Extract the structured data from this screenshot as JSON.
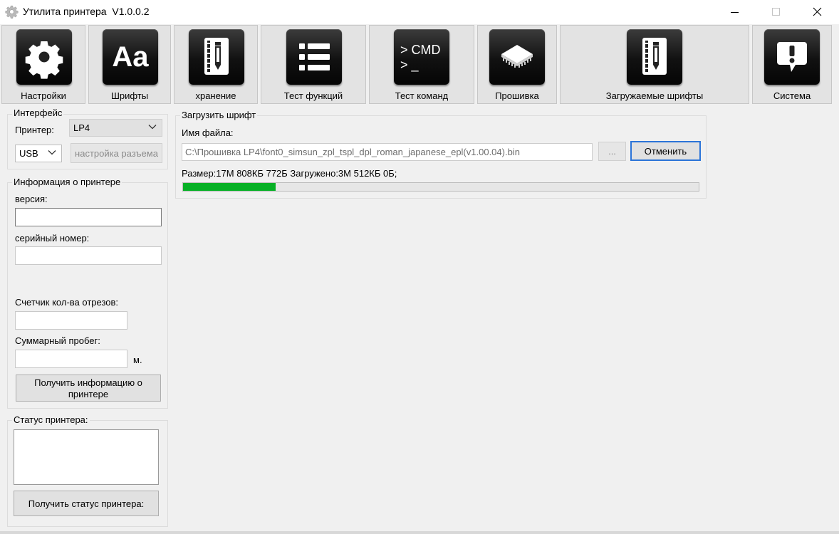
{
  "window": {
    "title": "Утилита принтера  V1.0.0.2",
    "icon": "gear-icon",
    "controls": [
      "minimize-icon",
      "maximize-icon",
      "close-icon"
    ]
  },
  "toolbar": {
    "items": [
      {
        "label": "Настройки",
        "icon": "gear-icon"
      },
      {
        "label": "Шрифты",
        "icon": "font-aa-icon",
        "icon_text": "Aa"
      },
      {
        "label": "хранение",
        "icon": "notebook-pencil-icon"
      },
      {
        "label": "Тест функций",
        "icon": "list-icon"
      },
      {
        "label": "Тест команд",
        "icon": "command-prompt-icon",
        "icon_text": "> CMD\n> _"
      },
      {
        "label": "Прошивка",
        "icon": "chip-icon"
      },
      {
        "label": "Загружаемые шрифты",
        "icon": "notebook-pencil-icon"
      },
      {
        "label": "Система",
        "icon": "alert-message-icon"
      }
    ]
  },
  "interface": {
    "legend": "Интерфейс",
    "printer_label": "Принтер:",
    "printer_value": "LP4",
    "port_value": "USB",
    "port_settings_button": "настройка разъема"
  },
  "printer_info": {
    "legend": "Информация о принтере",
    "version_label": "версия:",
    "version_value": "",
    "serial_label": "серийный номер:",
    "serial_value": "",
    "cut_counter_label": "Счетчик кол-ва отрезов:",
    "cut_counter_value": "",
    "mileage_label": "Суммарный пробег:",
    "mileage_value": "",
    "mileage_unit": "м.",
    "get_info_button": "Получить информацию о принтере"
  },
  "printer_status": {
    "legend": "Статус принтера:",
    "status_text": "",
    "get_status_button": "Получить статус принтера:"
  },
  "load_font": {
    "legend": "Загрузить шрифт",
    "filename_label": "Имя файла:",
    "file_path": "C:\\Прошивка LP4\\font0_simsun_zpl_tspl_dpl_roman_japanese_epl(v1.00.04).bin",
    "browse_button": "...",
    "cancel_button": "Отменить",
    "progress_text": "Размер:17М 808КБ 772Б Загружено:3М 512КБ 0Б;",
    "progress_fraction": 0.18,
    "progress_color": "#06b025"
  }
}
